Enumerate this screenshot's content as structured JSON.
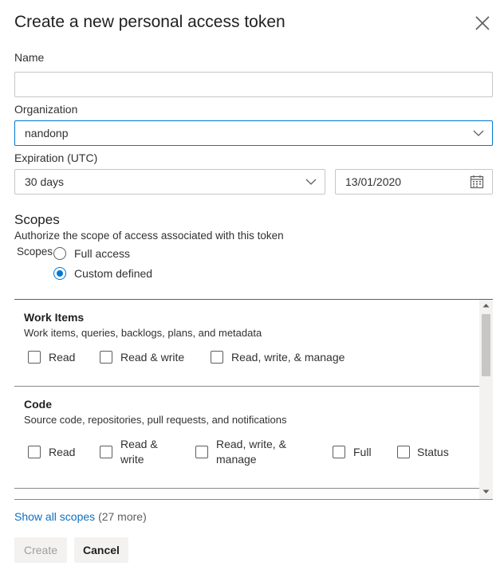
{
  "dialog": {
    "title": "Create a new personal access token"
  },
  "name": {
    "label": "Name",
    "value": ""
  },
  "organization": {
    "label": "Organization",
    "value": "nandonp"
  },
  "expiration": {
    "label": "Expiration (UTC)",
    "value": "30 days",
    "date": "13/01/2020"
  },
  "scopes": {
    "heading": "Scopes",
    "description": "Authorize the scope of access associated with this token",
    "radio_label": "Scopes",
    "options": [
      {
        "label": "Full access",
        "selected": false
      },
      {
        "label": "Custom defined",
        "selected": true
      }
    ],
    "sections": [
      {
        "title": "Work Items",
        "description": "Work items, queries, backlogs, plans, and metadata",
        "checkboxes": [
          "Read",
          "Read & write",
          "Read, write, & manage"
        ]
      },
      {
        "title": "Code",
        "description": "Source code, repositories, pull requests, and notifications",
        "checkboxes": [
          "Read",
          "Read & write",
          "Read, write, & manage",
          "Full",
          "Status"
        ]
      }
    ],
    "show_all_link": "Show all scopes",
    "more_count": "(27 more)"
  },
  "buttons": {
    "create": "Create",
    "cancel": "Cancel"
  },
  "colors": {
    "accent": "#0078d4",
    "link": "#106ebe"
  }
}
